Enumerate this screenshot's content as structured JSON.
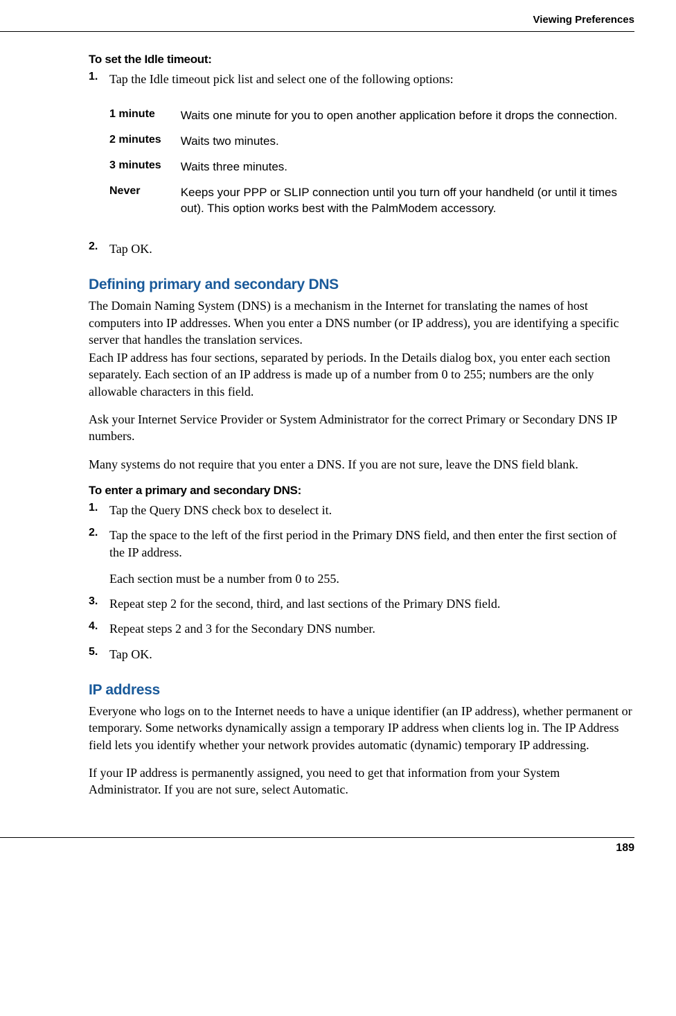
{
  "header": {
    "title": "Viewing Preferences"
  },
  "idle_timeout": {
    "heading": "To set the Idle timeout:",
    "step1_num": "1.",
    "step1_text": "Tap the Idle timeout pick list and select one of the following options:",
    "options": [
      {
        "label": "1 minute",
        "desc": "Waits one minute for you to open another application before it drops the connection."
      },
      {
        "label": "2 minutes",
        "desc": "Waits two minutes."
      },
      {
        "label": "3 minutes",
        "desc": "Waits three minutes."
      },
      {
        "label": "Never",
        "desc": "Keeps your PPP or SLIP connection until you turn off your handheld (or until it times out). This option works best with the PalmModem accessory."
      }
    ],
    "step2_num": "2.",
    "step2_text": "Tap OK."
  },
  "dns": {
    "heading": "Defining primary and secondary DNS",
    "para1": "The Domain Naming System (DNS) is a mechanism in the Internet for translating the names of host computers into IP addresses. When you enter a DNS number (or IP address), you are identifying a specific server that handles the translation services.",
    "para2": "Each IP address has four sections, separated by periods. In the Details dialog box, you enter each section separately. Each section of an IP address is made up of a number from 0 to 255; numbers are the only allowable characters in this field.",
    "para3": "Ask your Internet Service Provider or System Administrator for the correct Primary or Secondary DNS IP numbers.",
    "para4": "Many systems do not require that you enter a DNS. If you are not sure, leave the DNS field blank.",
    "subheading": "To enter a primary and secondary DNS:",
    "steps": [
      {
        "num": "1.",
        "text": "Tap the Query DNS check box to deselect it."
      },
      {
        "num": "2.",
        "text": "Tap the space to the left of the first period in the Primary DNS field, and then enter the first section of the IP address.",
        "sub": "Each section must be a number from 0 to 255."
      },
      {
        "num": "3.",
        "text": "Repeat step 2 for the second, third, and last sections of the Primary DNS field."
      },
      {
        "num": "4.",
        "text": "Repeat steps 2 and 3 for the Secondary DNS number."
      },
      {
        "num": "5.",
        "text": "Tap OK."
      }
    ]
  },
  "ip": {
    "heading": "IP address",
    "para1": "Everyone who logs on to the Internet needs to have a unique identifier (an IP address), whether permanent or temporary. Some networks dynamically assign a temporary IP address when clients log in. The IP Address field lets you identify whether your network provides automatic (dynamic) temporary IP addressing.",
    "para2": "If your IP address is permanently assigned, you need to get that information from your System Administrator. If you are not sure, select Automatic."
  },
  "footer": {
    "page": "189"
  }
}
